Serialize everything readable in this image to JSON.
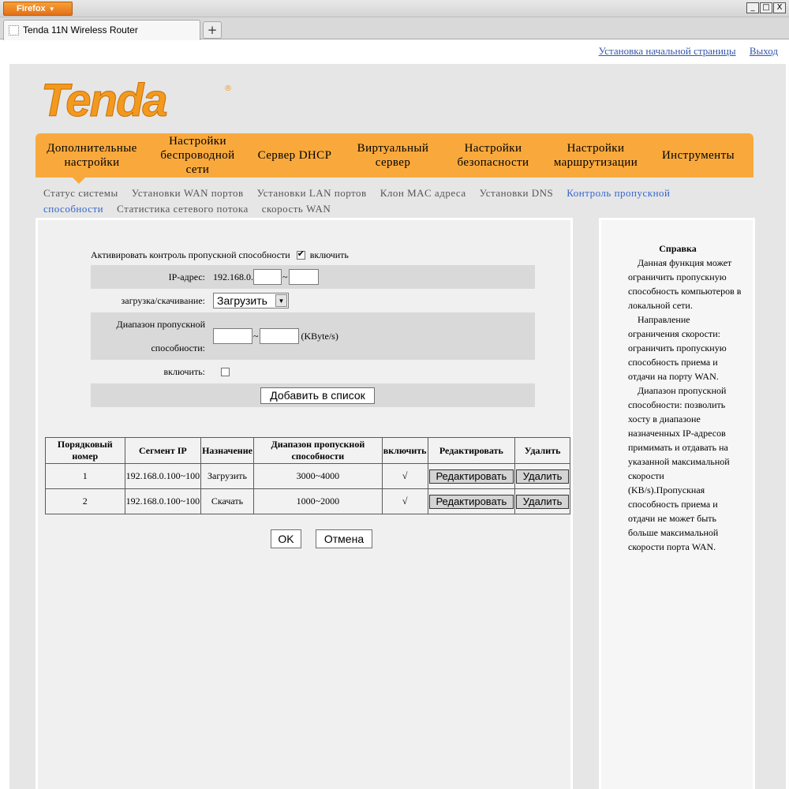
{
  "browser": {
    "menu_label": "Firefox",
    "tab_title": "Tenda 11N Wireless Router",
    "new_tab": "+",
    "window_buttons": [
      "_",
      "□",
      "X"
    ]
  },
  "toplinks": {
    "home": "Установка начальной страницы",
    "logout": "Выход"
  },
  "logo": {
    "text": "Tenda",
    "mark": "®",
    "color": "#f39a1e"
  },
  "nav": {
    "items": [
      {
        "line1": "Дополнительные",
        "line2": "настройки",
        "line3": ""
      },
      {
        "line1": "Настройки",
        "line2": "беспроводной",
        "line3": "сети"
      },
      {
        "line1": "Сервер DHCP",
        "line2": "",
        "line3": ""
      },
      {
        "line1": "Виртуальный",
        "line2": "сервер",
        "line3": ""
      },
      {
        "line1": "Настройки",
        "line2": "безопасности",
        "line3": ""
      },
      {
        "line1": "Настройки",
        "line2": "маршрутизации",
        "line3": ""
      },
      {
        "line1": "Инструменты",
        "line2": "",
        "line3": ""
      }
    ]
  },
  "subnav": {
    "items": [
      "Статус системы",
      "Установки WAN портов",
      "Установки LAN портов",
      "Клон MAC адреса",
      "Установки DNS",
      "Контроль пропускной способности",
      "Статистика сетевого потока",
      "скорость WAN"
    ],
    "active": "Контроль пропускной способности"
  },
  "form": {
    "activate_label": "Активировать контроль пропускной способности",
    "activate_checked": true,
    "activate_suffix": "включить",
    "ip_label": "IP-адрес:",
    "ip_prefix": "192.168.0.",
    "ip_from": "",
    "ip_to": "",
    "tilde": "~",
    "direction_label": "загрузка/скачивание:",
    "direction_value": "Загрузить",
    "dropdown_glyph": "▼",
    "range_label_1": "Диапазон пропускной",
    "range_label_2": "способности:",
    "range_from": "",
    "range_to": "",
    "range_unit": "(KByte/s)",
    "enable_label": "включить:",
    "enable_checked": false,
    "add_button": "Добавить в список"
  },
  "table": {
    "headers": [
      "Порядковый номер",
      "Сегмент IP",
      "Назначение",
      "Диапазон пропускной способности",
      "включить",
      "Редактировать",
      "Удалить"
    ],
    "rows": [
      {
        "num": "1",
        "ip": "192.168.0.100~100",
        "purpose": "Загрузить",
        "range": "3000~4000",
        "enabled": "√",
        "edit": "Редактировать",
        "delete": "Удалить"
      },
      {
        "num": "2",
        "ip": "192.168.0.100~100",
        "purpose": "Скачать",
        "range": "1000~2000",
        "enabled": "√",
        "edit": "Редактировать",
        "delete": "Удалить"
      }
    ]
  },
  "buttons": {
    "ok": "OK",
    "cancel": "Отмена"
  },
  "help": {
    "title": "Справка",
    "p1": "Данная функция может ограничить пропускную способность компьютеров в локальной сети.",
    "p2": "Направление ограничения скорости: ограничить пропускную способность приема и отдачи на порту WAN.",
    "p3": "Диапазон пропускной способности: позволить хосту в диапазоне назначенных IP-адресов примимать и отдавать на указанной максимальной скорости (KB/s).Пропускная способность приема и отдачи не может быть больше максимальной скорости порта WAN."
  },
  "colors": {
    "nav_bg": "#f9a93c",
    "link": "#3355aa",
    "active_sub": "#3366cc"
  }
}
